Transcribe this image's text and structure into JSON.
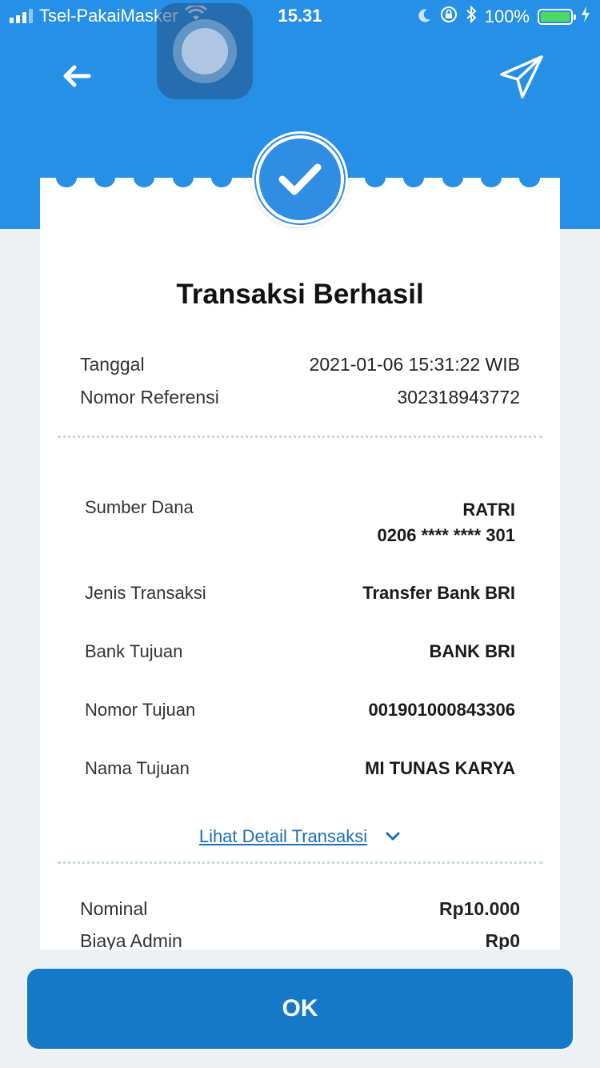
{
  "status_bar": {
    "carrier": "Tsel-PakaiMasker",
    "time": "15.31",
    "battery": "100%"
  },
  "header": {
    "back_icon": "arrow-left-icon",
    "share_icon": "paper-plane-icon",
    "accent_color": "#2590e6"
  },
  "receipt": {
    "title": "Transaksi Berhasil",
    "meta": [
      {
        "label": "Tanggal",
        "value": "2021-01-06 15:31:22 WIB"
      },
      {
        "label": "Nomor Referensi",
        "value": "302318943772"
      }
    ],
    "source": {
      "label": "Sumber Dana",
      "name": "RATRI",
      "account": "0206 **** **** 301"
    },
    "details": [
      {
        "label": "Jenis Transaksi",
        "value": "Transfer Bank BRI"
      },
      {
        "label": "Bank Tujuan",
        "value": "BANK BRI"
      },
      {
        "label": "Nomor Tujuan",
        "value": "001901000843306"
      },
      {
        "label": "Nama Tujuan",
        "value": "MI TUNAS KARYA"
      }
    ],
    "detail_link": "Lihat Detail Transaksi",
    "summary": [
      {
        "label": "Nominal",
        "value": "Rp10.000"
      },
      {
        "label": "Biaya Admin",
        "value": "Rp0"
      }
    ]
  },
  "ok_button": "OK"
}
